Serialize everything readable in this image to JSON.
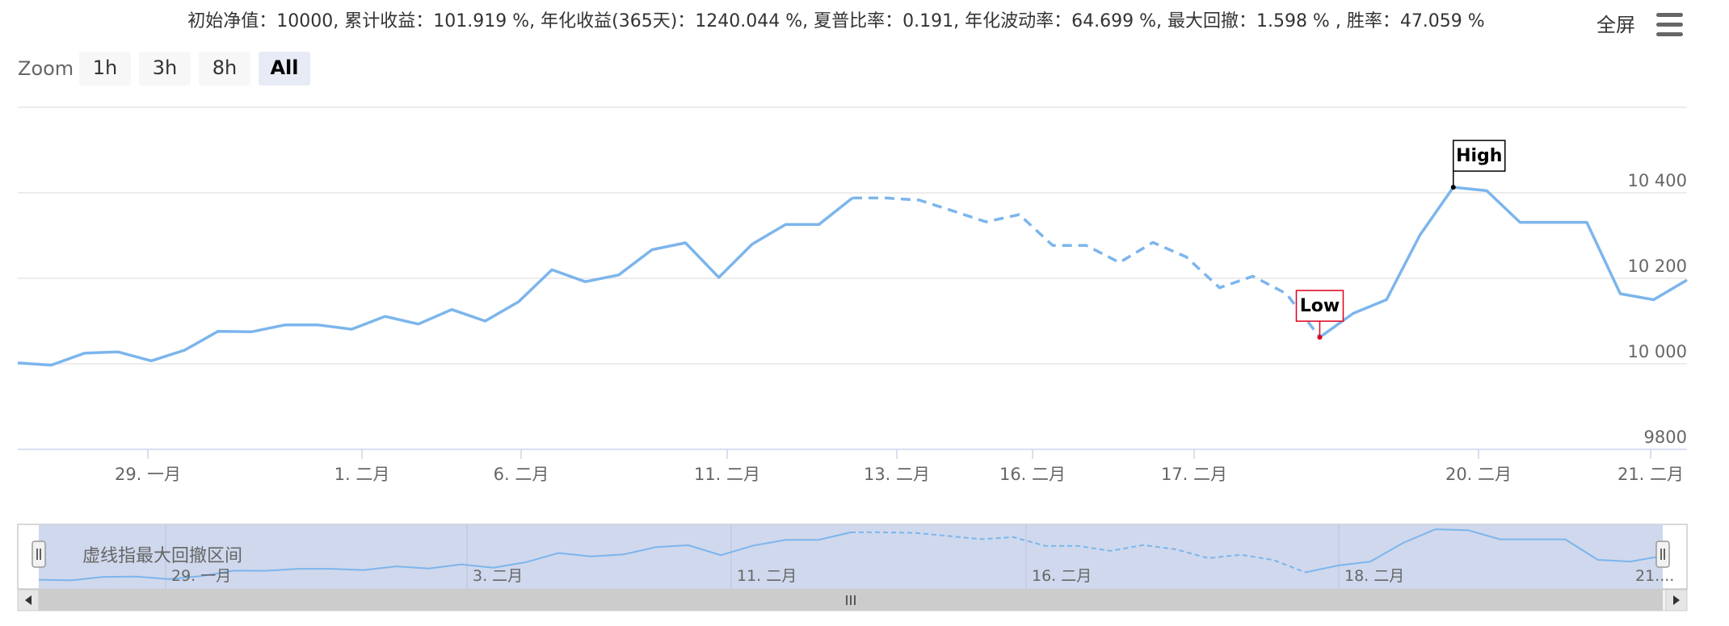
{
  "header": {
    "stats": "初始净值：10000, 累计收益：101.919 %, 年化收益(365天)：1240.044 %, 夏普比率：0.191, 年化波动率：64.699 %, 最大回撤：1.598 % , 胜率：47.059 %",
    "fullscreen_label": "全屏"
  },
  "zoom": {
    "label": "Zoom",
    "buttons": [
      {
        "label": "1h",
        "active": false
      },
      {
        "label": "3h",
        "active": false
      },
      {
        "label": "8h",
        "active": false
      },
      {
        "label": "All",
        "active": true
      }
    ]
  },
  "navigator": {
    "note": "虚线指最大回撤区间",
    "x_ticks": [
      "29. 一月",
      "3. 二月",
      "11. 二月",
      "16. 二月",
      "18. 二月",
      "21...."
    ]
  },
  "chart_data": {
    "type": "line",
    "title": "",
    "xlabel": "",
    "ylabel": "",
    "ylim": [
      9800,
      10600
    ],
    "y_ticks": [
      "9800",
      "10 000",
      "10 200",
      "10 400"
    ],
    "x_ticks": [
      "29. 一月",
      "1. 二月",
      "6. 二月",
      "11. 二月",
      "13. 二月",
      "16. 二月",
      "17. 二月",
      "20. 二月",
      "21. 二月"
    ],
    "series": [
      {
        "color": "#7cb5ec",
        "values": [
          10002,
          9997,
          10025,
          10028,
          10007,
          10032,
          10076,
          10075,
          10091,
          10091,
          10081,
          10111,
          10093,
          10127,
          10100,
          10145,
          10220,
          10192,
          10208,
          10267,
          10283,
          10202,
          10280,
          10326,
          10326,
          10388,
          10388,
          10383,
          10358,
          10332,
          10349,
          10277,
          10277,
          10237,
          10284,
          10250,
          10178,
          10205,
          10164,
          10062,
          10118,
          10150,
          10301,
          10413,
          10405,
          10331,
          10331,
          10331,
          10164,
          10150,
          10196
        ],
        "drawdown_start_index": 25,
        "drawdown_end_index": 39
      }
    ],
    "annotations": [
      {
        "label": "High",
        "index": 43,
        "color": "#000000"
      },
      {
        "label": "Low",
        "index": 39,
        "color": "#e0001b"
      }
    ]
  }
}
